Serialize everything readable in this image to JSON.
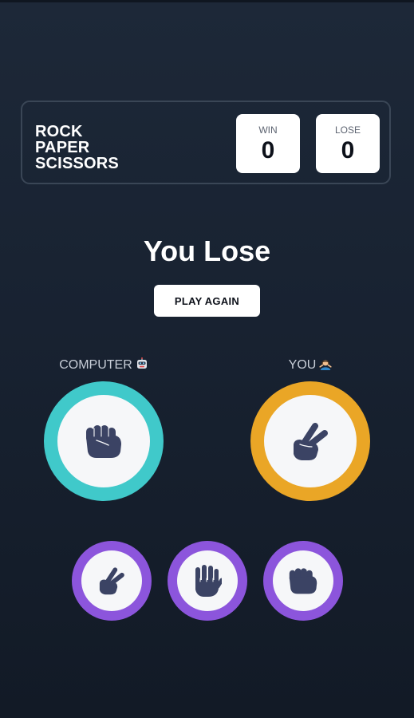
{
  "title_lines": [
    "ROCK",
    "PAPER",
    "SCISSORS"
  ],
  "score": {
    "win_label": "WIN",
    "win_value": "0",
    "lose_label": "LOSE",
    "lose_value": "0"
  },
  "result_text": "You Lose",
  "play_again_label": "PLAY AGAIN",
  "computer": {
    "label": "COMPUTER",
    "emoji_icon": "robot-icon",
    "choice": "rock",
    "ring_color": "#40c9ca"
  },
  "you": {
    "label": "YOU",
    "emoji_icon": "person-icon",
    "choice": "scissors",
    "ring_color": "#eaa626"
  },
  "choices": [
    {
      "name": "scissors",
      "icon": "scissors-hand-icon"
    },
    {
      "name": "paper",
      "icon": "paper-hand-icon"
    },
    {
      "name": "rock",
      "icon": "rock-hand-icon"
    }
  ],
  "colors": {
    "choice_ring": "#8c55dc",
    "hand": "#3b4364",
    "background": "#1b2535"
  }
}
